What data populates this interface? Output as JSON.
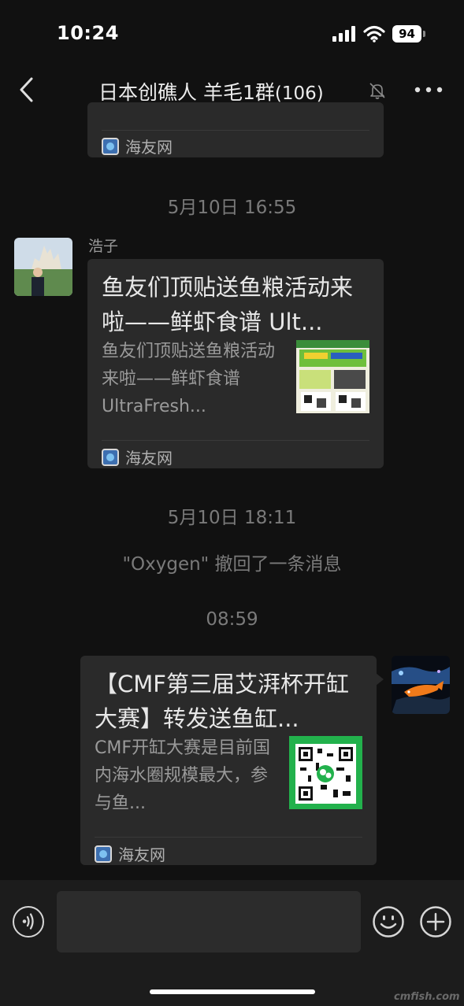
{
  "status_bar": {
    "time": "10:24",
    "battery": "94"
  },
  "nav": {
    "title": "日本创礁人 羊毛1群",
    "member_count": "(106)"
  },
  "messages": {
    "top_card": {
      "source": "海友网"
    },
    "ts1": "5月10日 16:55",
    "msg1": {
      "sender": "浩子",
      "title": "鱼友们顶贴送鱼粮活动来啦——鲜虾食谱 Ult...",
      "desc": "鱼友们顶贴送鱼粮活动来啦——鲜虾食谱 UltraFresh...",
      "source": "海友网"
    },
    "ts2": "5月10日 18:11",
    "recall": "\"Oxygen\" 撤回了一条消息",
    "ts3": "08:59",
    "msg2": {
      "title": "【CMF第三届艾湃杯开缸大赛】转发送鱼缸...",
      "desc": "CMF开缸大赛是目前国内海水圈规模最大，参与鱼...",
      "source": "海友网"
    }
  },
  "input": {
    "value": ""
  },
  "watermark": "cmfish.com",
  "colors": {
    "background": "#111111",
    "card": "#2a2a2a",
    "qr_green": "#22b14c"
  }
}
